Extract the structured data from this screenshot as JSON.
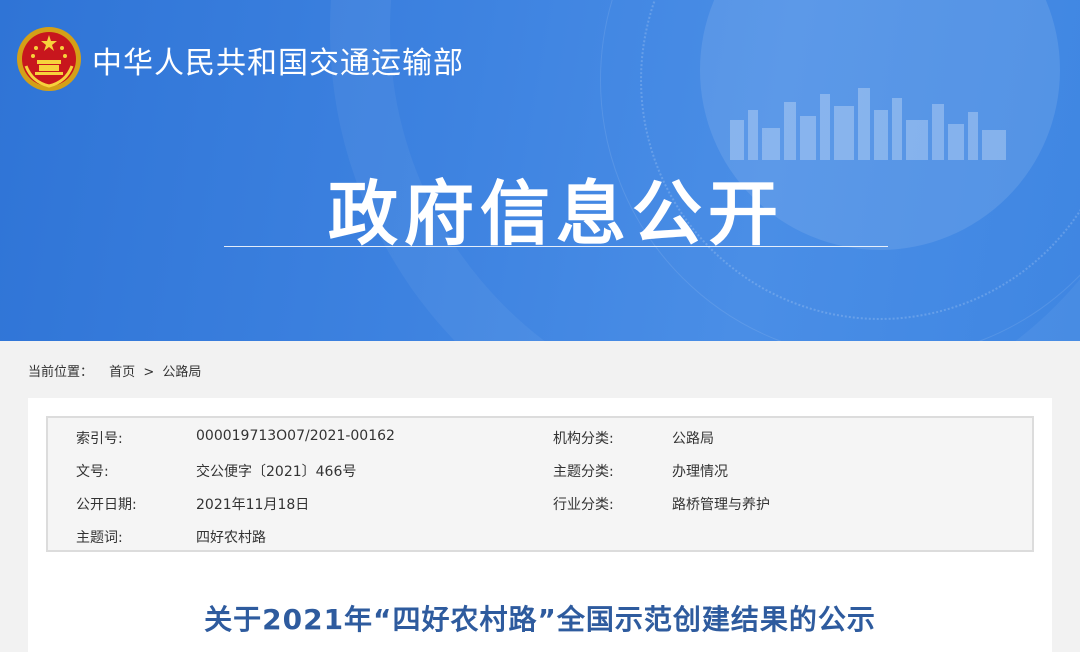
{
  "header": {
    "ministry_name": "中华人民共和国交通运输部",
    "section_title": "政府信息公开",
    "colors": {
      "banner": "#3d82e0",
      "title_blue": "#2e5b9e"
    }
  },
  "breadcrumb": {
    "label": "当前位置：",
    "items": [
      "首页",
      "公路局"
    ],
    "separator": ">"
  },
  "metadata": {
    "rows": [
      {
        "k1": "索引号:",
        "v1": "000019713O07/2021-00162",
        "k2": "机构分类:",
        "v2": "公路局"
      },
      {
        "k1": "文号:",
        "v1": "交公便字〔2021〕466号",
        "k2": "主题分类:",
        "v2": "办理情况"
      },
      {
        "k1": "公开日期:",
        "v1": "2021年11月18日",
        "k2": "行业分类:",
        "v2": "路桥管理与养护"
      },
      {
        "k1": "主题词:",
        "v1": "四好农村路",
        "k2": "",
        "v2": ""
      }
    ]
  },
  "document": {
    "title": "关于2021年“四好农村路”全国示范创建结果的公示"
  }
}
